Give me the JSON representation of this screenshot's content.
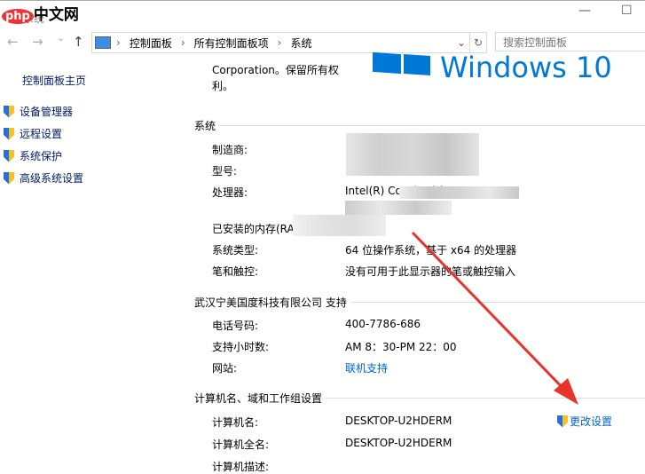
{
  "watermark": "php中文网",
  "window": {
    "title": "系统",
    "minimize": "—",
    "maximize": "☐"
  },
  "nav": {
    "back": "←",
    "forward": "→",
    "recent": "⌄",
    "up": "↑"
  },
  "breadcrumb": [
    "控制面板",
    "所有控制面板项",
    "系统"
  ],
  "search": {
    "placeholder": "搜索控制面板"
  },
  "sidebar": {
    "home": "控制面板主页",
    "items": [
      {
        "label": "设备管理器"
      },
      {
        "label": "远程设置"
      },
      {
        "label": "系统保护"
      },
      {
        "label": "高级系统设置"
      }
    ]
  },
  "copyright": "Corporation。保留所有权利。",
  "brand": "Windows 10",
  "system": {
    "heading": "系统",
    "rows": [
      {
        "label": "制造商:",
        "value": ""
      },
      {
        "label": "型号:",
        "value": ""
      },
      {
        "label": "处理器:",
        "value": "Intel(R) Core(TM) i"
      },
      {
        "label": "已安装的内存(RAM):",
        "value": ""
      },
      {
        "label": "系统类型:",
        "value": "64 位操作系统，基于 x64 的处理器"
      },
      {
        "label": "笔和触控:",
        "value": "没有可用于此显示器的笔或触控输入"
      }
    ]
  },
  "support": {
    "heading": "武汉宁美国度科技有限公司 支持",
    "rows": [
      {
        "label": "电话号码:",
        "value": "400-7786-686"
      },
      {
        "label": "支持小时数:",
        "value": "AM 8：30-PM 22：00"
      },
      {
        "label": "网站:",
        "value": "联机支持"
      }
    ]
  },
  "computer": {
    "heading": "计算机名、域和工作组设置",
    "change": "更改设置",
    "rows": [
      {
        "label": "计算机名:",
        "value": "DESKTOP-U2HDERM"
      },
      {
        "label": "计算机全名:",
        "value": "DESKTOP-U2HDERM"
      },
      {
        "label": "计算机描述:",
        "value": ""
      }
    ]
  },
  "colors": {
    "accent": "#0078d7",
    "arrow": "#e8332a"
  }
}
